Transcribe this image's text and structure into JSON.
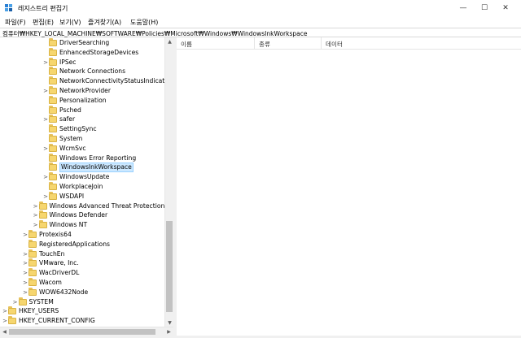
{
  "window": {
    "title": "레지스트리 편집기",
    "minimize_glyph": "—",
    "maximize_glyph": "☐",
    "close_glyph": "✕"
  },
  "menu": [
    {
      "label": "파일(F)"
    },
    {
      "label": "편집(E)"
    },
    {
      "label": "보기(V)"
    },
    {
      "label": "즐겨찾기(A)"
    },
    {
      "label": "도움말(H)"
    }
  ],
  "address": "컴퓨터₩HKEY_LOCAL_MACHINE₩SOFTWARE₩Policies₩Microsoft₩Windows₩WindowsInkWorkspace",
  "tree": [
    {
      "label": "DriverSearching",
      "level": 4,
      "expander": "",
      "selected": false
    },
    {
      "label": "EnhancedStorageDevices",
      "level": 4,
      "expander": "",
      "selected": false
    },
    {
      "label": "IPSec",
      "level": 4,
      "expander": ">",
      "selected": false
    },
    {
      "label": "Network Connections",
      "level": 4,
      "expander": "",
      "selected": false
    },
    {
      "label": "NetworkConnectivityStatusIndicator",
      "level": 4,
      "expander": "",
      "selected": false
    },
    {
      "label": "NetworkProvider",
      "level": 4,
      "expander": ">",
      "selected": false
    },
    {
      "label": "Personalization",
      "level": 4,
      "expander": "",
      "selected": false
    },
    {
      "label": "Psched",
      "level": 4,
      "expander": "",
      "selected": false
    },
    {
      "label": "safer",
      "level": 4,
      "expander": ">",
      "selected": false
    },
    {
      "label": "SettingSync",
      "level": 4,
      "expander": "",
      "selected": false
    },
    {
      "label": "System",
      "level": 4,
      "expander": "",
      "selected": false
    },
    {
      "label": "WcmSvc",
      "level": 4,
      "expander": ">",
      "selected": false
    },
    {
      "label": "Windows Error Reporting",
      "level": 4,
      "expander": "",
      "selected": false
    },
    {
      "label": "WindowsInkWorkspace",
      "level": 4,
      "expander": "",
      "selected": true
    },
    {
      "label": "WindowsUpdate",
      "level": 4,
      "expander": ">",
      "selected": false
    },
    {
      "label": "WorkplaceJoin",
      "level": 4,
      "expander": "",
      "selected": false
    },
    {
      "label": "WSDAPI",
      "level": 4,
      "expander": ">",
      "selected": false
    },
    {
      "label": "Windows Advanced Threat Protection",
      "level": 3,
      "expander": ">",
      "selected": false
    },
    {
      "label": "Windows Defender",
      "level": 3,
      "expander": ">",
      "selected": false
    },
    {
      "label": "Windows NT",
      "level": 3,
      "expander": ">",
      "selected": false
    },
    {
      "label": "Protexis64",
      "level": 2,
      "expander": ">",
      "selected": false
    },
    {
      "label": "RegisteredApplications",
      "level": 2,
      "expander": "",
      "selected": false
    },
    {
      "label": "TouchEn",
      "level": 2,
      "expander": ">",
      "selected": false
    },
    {
      "label": "VMware, Inc.",
      "level": 2,
      "expander": ">",
      "selected": false
    },
    {
      "label": "WacDriverDL",
      "level": 2,
      "expander": ">",
      "selected": false
    },
    {
      "label": "Wacom",
      "level": 2,
      "expander": ">",
      "selected": false
    },
    {
      "label": "WOW6432Node",
      "level": 2,
      "expander": ">",
      "selected": false
    },
    {
      "label": "SYSTEM",
      "level": 1,
      "expander": ">",
      "selected": false
    },
    {
      "label": "HKEY_USERS",
      "level": 0,
      "expander": ">",
      "selected": false
    },
    {
      "label": "HKEY_CURRENT_CONFIG",
      "level": 0,
      "expander": ">",
      "selected": false
    }
  ],
  "list": {
    "columns": [
      "이름",
      "종류",
      "데이터"
    ]
  },
  "scroll": {
    "up_glyph": "▲",
    "down_glyph": "▼",
    "left_glyph": "◀",
    "right_glyph": "▶"
  },
  "colors": {
    "selection_bg": "#cce8ff",
    "folder": "#f6d66f"
  },
  "icons": {
    "app": "registry-editor-icon",
    "folder": "folder-icon",
    "expander": "chevron-right-icon"
  }
}
